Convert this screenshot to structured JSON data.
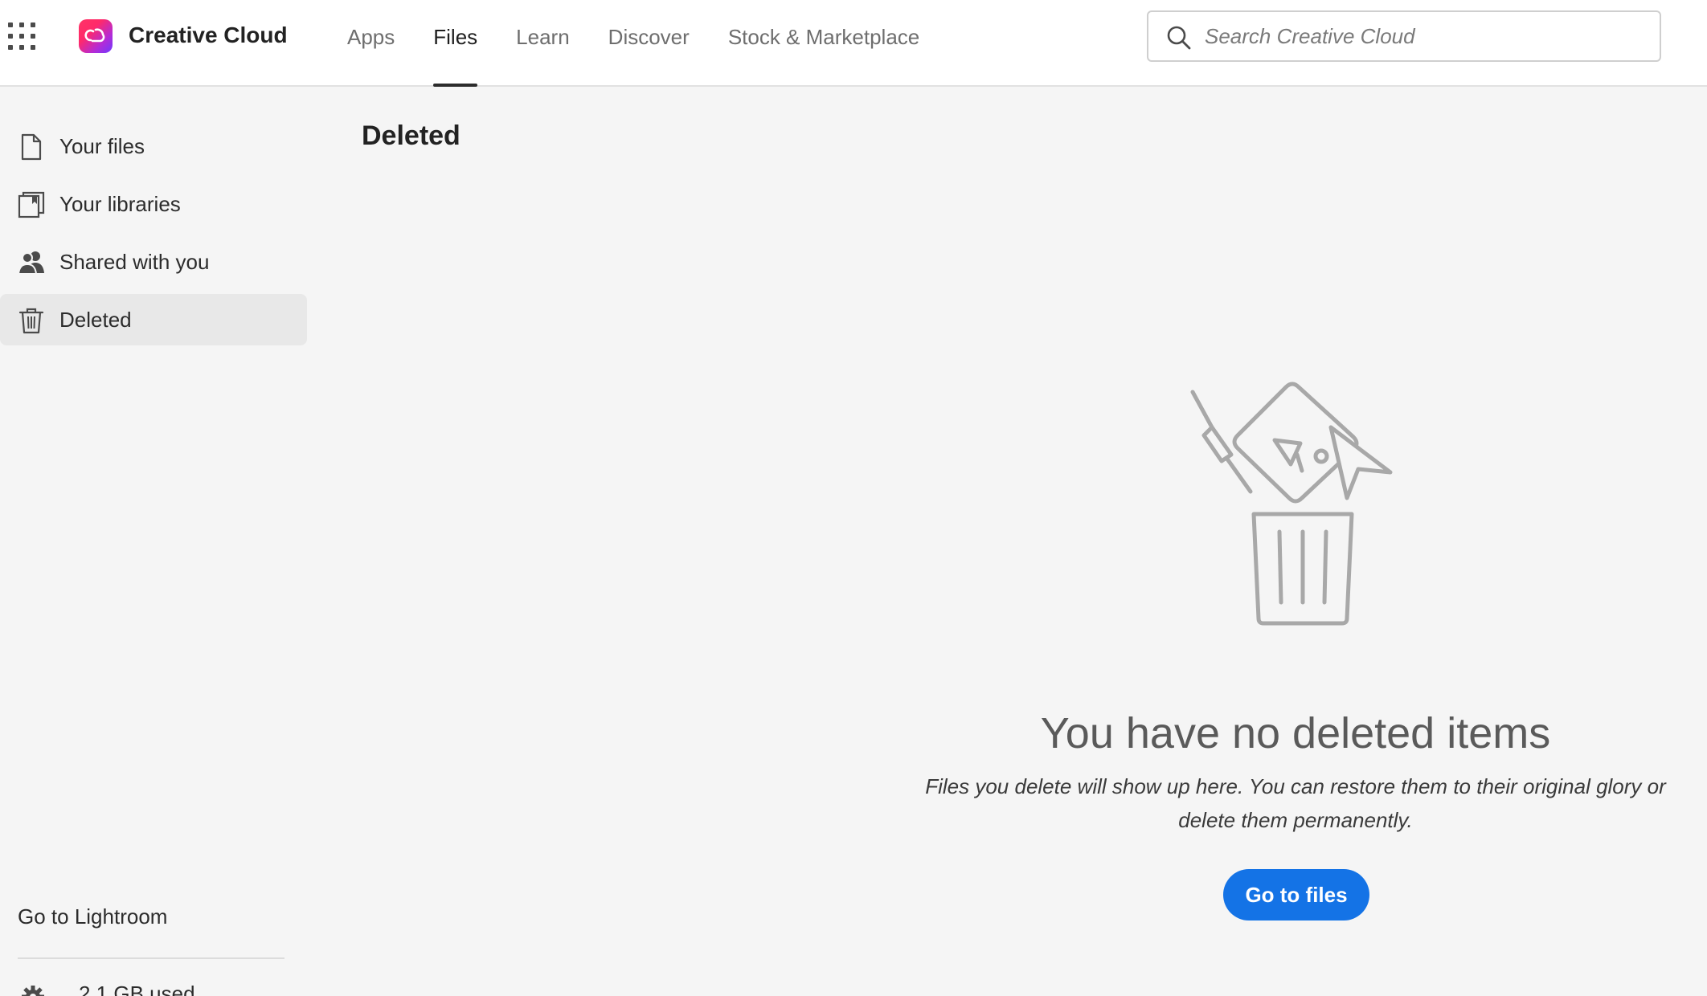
{
  "header": {
    "brand": "Creative Cloud",
    "nav": [
      {
        "label": "Apps"
      },
      {
        "label": "Files"
      },
      {
        "label": "Learn"
      },
      {
        "label": "Discover"
      },
      {
        "label": "Stock & Marketplace"
      }
    ],
    "active_nav": "Files",
    "search": {
      "placeholder": "Search Creative Cloud",
      "value": ""
    }
  },
  "sidebar": {
    "items": [
      {
        "label": "Your files",
        "icon": "file-icon"
      },
      {
        "label": "Your libraries",
        "icon": "libraries-icon"
      },
      {
        "label": "Shared with you",
        "icon": "people-icon"
      },
      {
        "label": "Deleted",
        "icon": "trash-icon"
      }
    ],
    "active_item": "Deleted",
    "lightroom_link": "Go to Lightroom",
    "storage_text": "2.1 GB used"
  },
  "main": {
    "title": "Deleted",
    "empty_state": {
      "icon": "trash-with-items-icon",
      "heading": "You have no deleted items",
      "description": "Files you delete will show up here. You can restore them to their original glory or delete them permanently.",
      "button_label": "Go to files"
    }
  },
  "colors": {
    "accent": "#1473e6",
    "background": "#f5f5f5",
    "active_item_bg": "#e8e8e8"
  }
}
